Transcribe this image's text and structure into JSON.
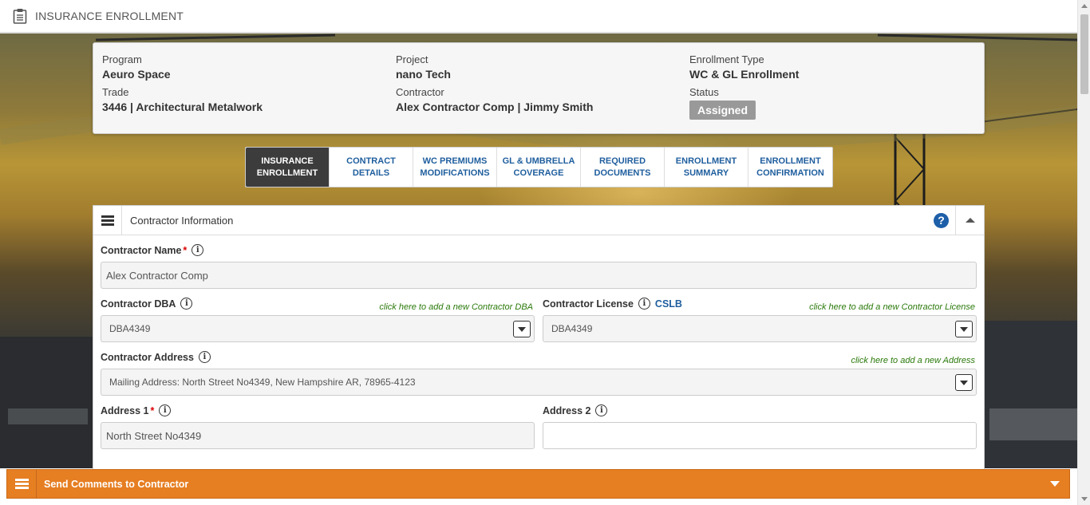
{
  "header": {
    "title": "INSURANCE ENROLLMENT",
    "icon": "clipboard-icon"
  },
  "summary": {
    "program_label": "Program",
    "program_value": "Aeuro Space",
    "project_label": "Project",
    "project_value": "nano Tech",
    "enrollment_type_label": "Enrollment Type",
    "enrollment_type_value": "WC & GL Enrollment",
    "trade_label": "Trade",
    "trade_value": "3446 | Architectural Metalwork",
    "contractor_label": "Contractor",
    "contractor_value": "Alex Contractor Comp | Jimmy Smith",
    "status_label": "Status",
    "status_value": "Assigned"
  },
  "tabs": [
    {
      "line1": "INSURANCE",
      "line2": "ENROLLMENT",
      "active": true
    },
    {
      "line1": "CONTRACT",
      "line2": "DETAILS"
    },
    {
      "line1": "WC PREMIUMS",
      "line2": "MODIFICATIONS"
    },
    {
      "line1": "GL & UMBRELLA",
      "line2": "COVERAGE"
    },
    {
      "line1": "REQUIRED",
      "line2": "DOCUMENTS"
    },
    {
      "line1": "ENROLLMENT",
      "line2": "SUMMARY"
    },
    {
      "line1": "ENROLLMENT",
      "line2": "CONFIRMATION"
    }
  ],
  "panel": {
    "title": "Contractor Information",
    "help": "?",
    "contractor_name_label": "Contractor Name",
    "contractor_name_value": "Alex Contractor Comp",
    "dba_label": "Contractor DBA",
    "dba_link": "click here to add a new Contractor DBA",
    "dba_value": "DBA4349",
    "license_label": "Contractor License",
    "license_cslb": "CSLB",
    "license_link": "click here to add a new Contractor License",
    "license_value": "DBA4349",
    "address_label": "Contractor Address",
    "address_link": "click here to add a new Address",
    "address_value": "Mailing Address: North Street No4349, New Hampshire AR, 78965-4123",
    "address1_label": "Address 1",
    "address1_value": "North Street No4349",
    "address2_label": "Address 2",
    "address2_value": "",
    "required_mark": "*",
    "info_glyph": "i"
  },
  "footer": {
    "title": "Send Comments to Contractor"
  },
  "colors": {
    "accent_orange": "#e67e22",
    "link_blue": "#1f5e9e",
    "tab_active": "#3c3c3c",
    "add_link_green": "#2b7a0b"
  }
}
